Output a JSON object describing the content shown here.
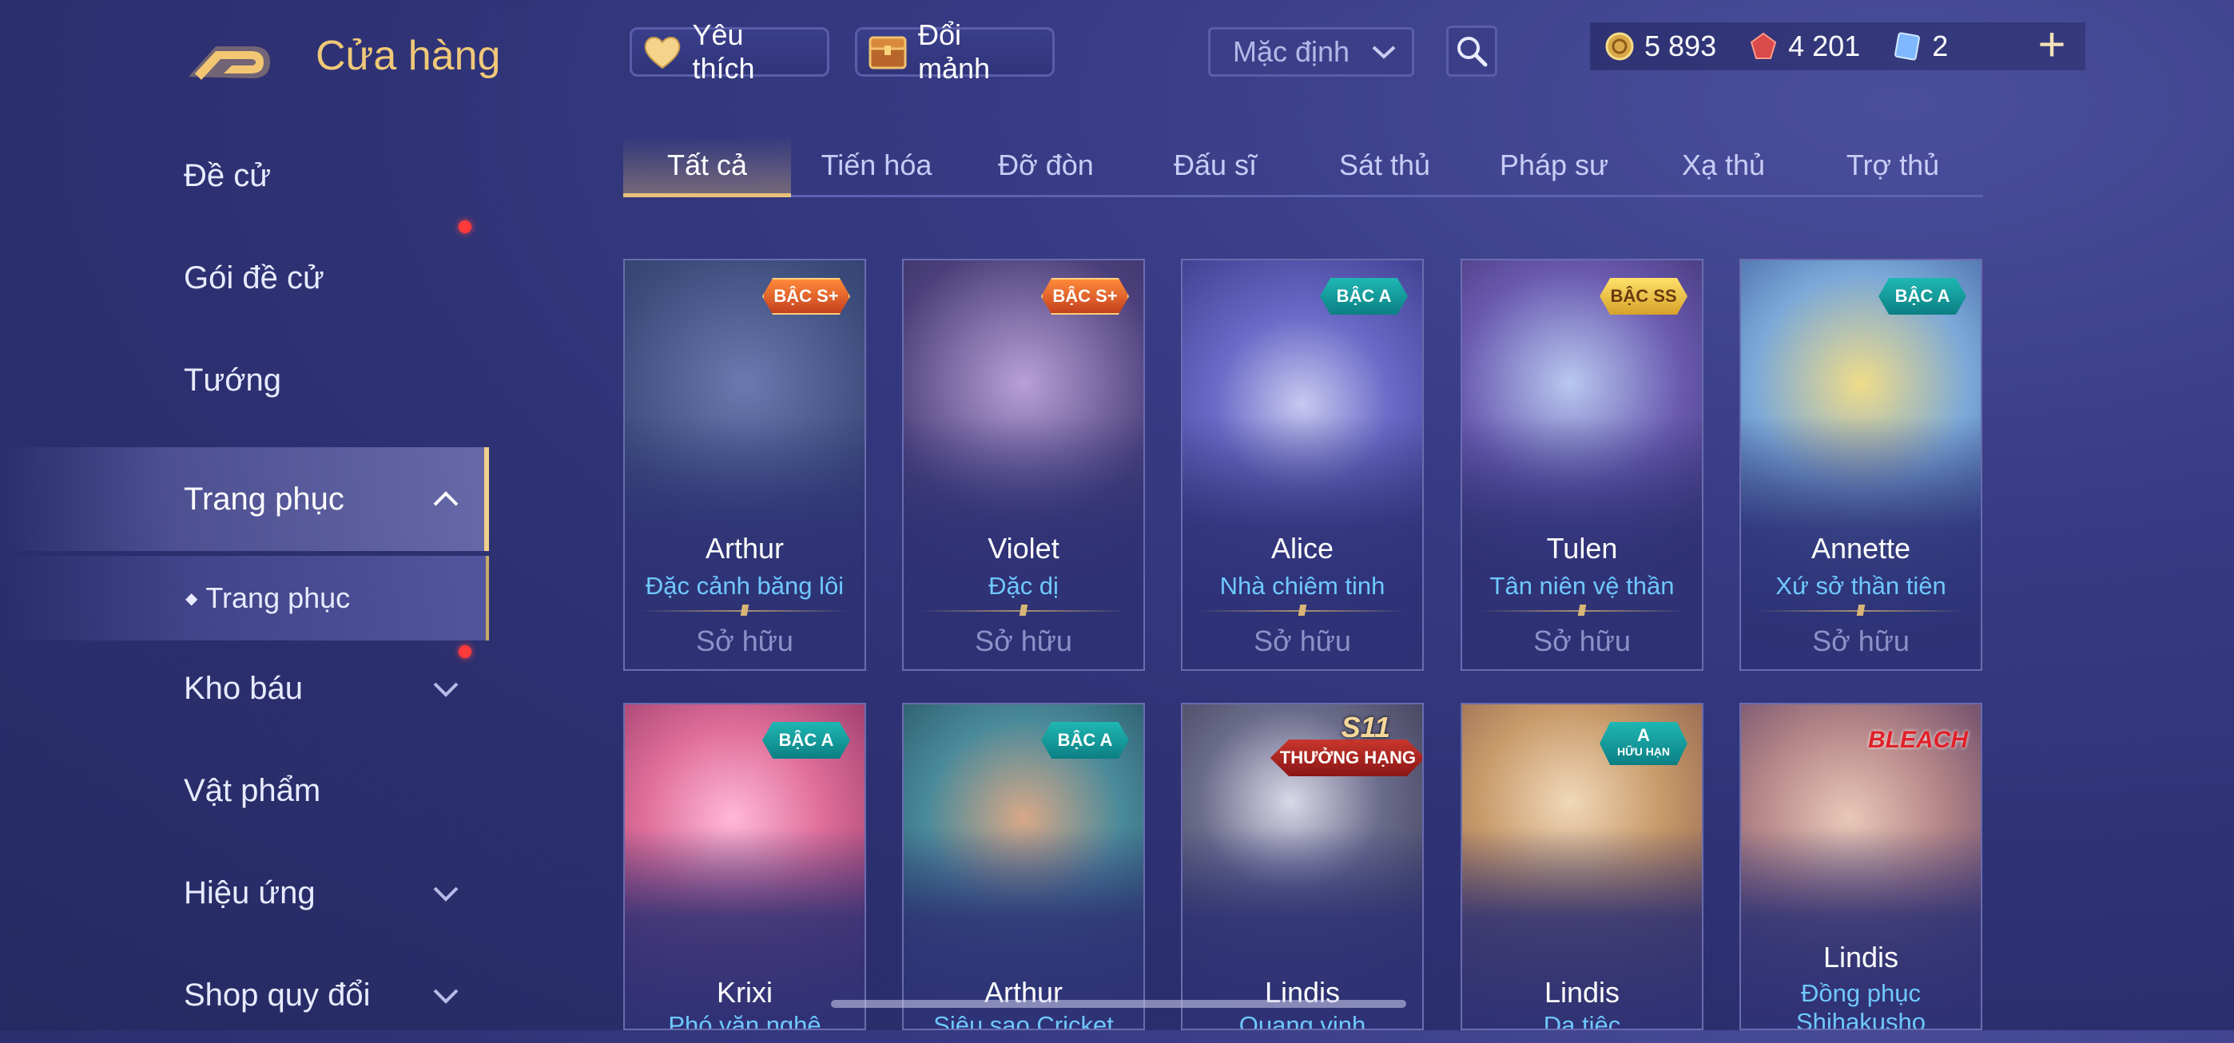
{
  "header": {
    "title": "Cửa hàng",
    "favorites_label": "Yêu thích",
    "exchange_label": "Đổi mảnh",
    "sort_value": "Mặc định",
    "currencies": [
      {
        "icon": "gold-coin-icon",
        "value": "5 893"
      },
      {
        "icon": "red-gem-icon",
        "value": "4 201"
      },
      {
        "icon": "ticket-icon",
        "value": "2"
      }
    ]
  },
  "sidebar": {
    "items": [
      {
        "label": "Đề cử"
      },
      {
        "label": "Gói đề cử"
      },
      {
        "label": "Tướng"
      },
      {
        "label": "Trang phục"
      },
      {
        "label": "Trang phục"
      },
      {
        "label": "Kho báu"
      },
      {
        "label": "Vật phẩm"
      },
      {
        "label": "Hiệu ứng"
      },
      {
        "label": "Shop quy đổi"
      }
    ]
  },
  "tabs": [
    "Tất cả",
    "Tiến hóa",
    "Đỡ đòn",
    "Đấu sĩ",
    "Sát thủ",
    "Pháp sư",
    "Xạ thủ",
    "Trợ thủ"
  ],
  "cards": [
    {
      "hero": "Arthur",
      "skin": "Đặc cảnh băng lôi",
      "status": "Sở hữu",
      "badge": "BẬC S+",
      "color": "#3a4a7a"
    },
    {
      "hero": "Violet",
      "skin": "Đặc dị",
      "status": "Sở hữu",
      "badge": "BẬC S+",
      "color": "#4a3f7a"
    },
    {
      "hero": "Alice",
      "skin": "Nhà chiêm tinh",
      "status": "Sở hữu",
      "badge": "BẬC A",
      "color": "#4b4a9a"
    },
    {
      "hero": "Tulen",
      "skin": "Tân niên vệ thần",
      "status": "Sở hữu",
      "badge": "BẬC SS",
      "color": "#5b4f8a"
    },
    {
      "hero": "Annette",
      "skin": "Xứ sở thần tiên",
      "status": "Sở hữu",
      "badge": "BẬC A",
      "color": "#3f6a9a"
    },
    {
      "hero": "Krixi",
      "skin": "Phó văn nghệ",
      "badge": "BẬC A",
      "color": "#b85a8a"
    },
    {
      "hero": "Arthur",
      "skin": "Siêu sao Cricket",
      "badge": "BẬC A",
      "color": "#3f7a8a"
    },
    {
      "hero": "Lindis",
      "skin": "Quang vinh",
      "badge_top": "S11",
      "badge": "THƯỞNG HẠNG",
      "color": "#4a4f72"
    },
    {
      "hero": "Lindis",
      "skin": "Dạ tiệc",
      "badge_top": "A",
      "badge": "HỮU HẠN",
      "color": "#8a6a5a"
    },
    {
      "hero": "Lindis",
      "skin": "Đồng phục Shihakusho",
      "badge": "BLEACH",
      "color": "#6a5a7a"
    }
  ]
}
